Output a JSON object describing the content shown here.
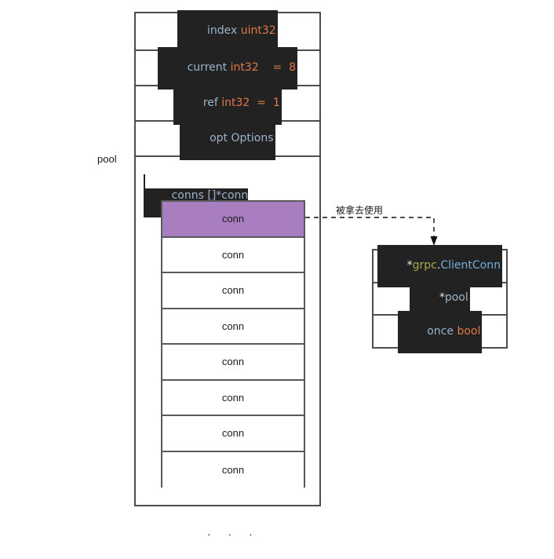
{
  "diagram": {
    "pool": {
      "label": "pool",
      "fields": [
        {
          "name": "index-field",
          "tokens": [
            {
              "text": "index ",
              "kind": "ident"
            },
            {
              "text": "uint32",
              "kind": "type"
            }
          ]
        },
        {
          "name": "current-field",
          "tokens": [
            {
              "text": "current ",
              "kind": "ident"
            },
            {
              "text": "int32",
              "kind": "type"
            },
            {
              "text": "    =  8",
              "kind": "num"
            }
          ]
        },
        {
          "name": "ref-field",
          "tokens": [
            {
              "text": "ref ",
              "kind": "ident"
            },
            {
              "text": "int32",
              "kind": "type"
            },
            {
              "text": "  =  1",
              "kind": "num"
            }
          ]
        },
        {
          "name": "opt-field",
          "tokens": [
            {
              "text": "opt Options",
              "kind": "ident"
            }
          ]
        }
      ],
      "conns_field": {
        "tokens": [
          {
            "text": "conns []*conn",
            "kind": "ident"
          }
        ]
      },
      "conns": [
        {
          "label": "conn",
          "active": true
        },
        {
          "label": "conn",
          "active": false
        },
        {
          "label": "conn",
          "active": false
        },
        {
          "label": "conn",
          "active": false
        },
        {
          "label": "conn",
          "active": false
        },
        {
          "label": "conn",
          "active": false
        },
        {
          "label": "conn",
          "active": false
        },
        {
          "label": "conn",
          "active": false
        }
      ],
      "ellipsis": "· · ·"
    },
    "connector": {
      "label": "被拿去使用",
      "style": "dashed-arrow"
    },
    "client_conn": {
      "rows": [
        {
          "name": "grpc-clientconn-field",
          "tokens": [
            {
              "text": "*",
              "kind": "punct"
            },
            {
              "text": "grpc",
              "kind": "pkg"
            },
            {
              "text": ".",
              "kind": "punct"
            },
            {
              "text": "ClientConn",
              "kind": "cls"
            }
          ]
        },
        {
          "name": "pool-pointer-field",
          "tokens": [
            {
              "text": "*",
              "kind": "punct"
            },
            {
              "text": "pool",
              "kind": "ident"
            }
          ]
        },
        {
          "name": "once-bool-field",
          "tokens": [
            {
              "text": "once ",
              "kind": "ident"
            },
            {
              "text": "bool",
              "kind": "type"
            }
          ]
        }
      ]
    },
    "colors": {
      "highlight": "#a87ec0",
      "code_bg": "#222222",
      "identifier": "#9cb3c9",
      "type": "#e0794a",
      "package": "#a3a84a",
      "class": "#77aede",
      "border": "#4d4d4d"
    }
  }
}
